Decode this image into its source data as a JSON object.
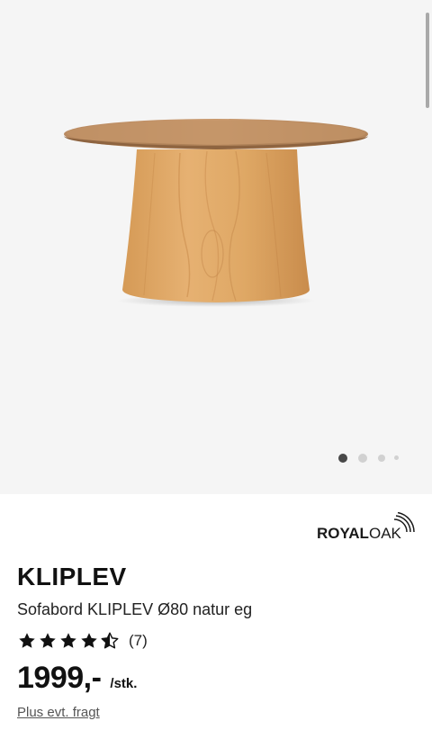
{
  "gallery": {
    "image_alt": "Sofabord KLIPLEV Ø80 natur eg",
    "slide_count": 4,
    "active_slide": 1
  },
  "brand": {
    "name_part1": "ROYAL",
    "name_part2": "OAK"
  },
  "product": {
    "name": "KLIPLEV",
    "description": "Sofabord KLIPLEV Ø80 natur eg",
    "rating": 4.5,
    "rating_max": 5,
    "review_count": "(7)",
    "price": "1999,-",
    "price_unit": "/stk.",
    "shipping_note": "Plus evt. fragt"
  },
  "colors": {
    "gallery_background": "#f5f5f5",
    "star": "#111111",
    "dot_active": "#484848",
    "dot_inactive": "#d1d1d1"
  }
}
